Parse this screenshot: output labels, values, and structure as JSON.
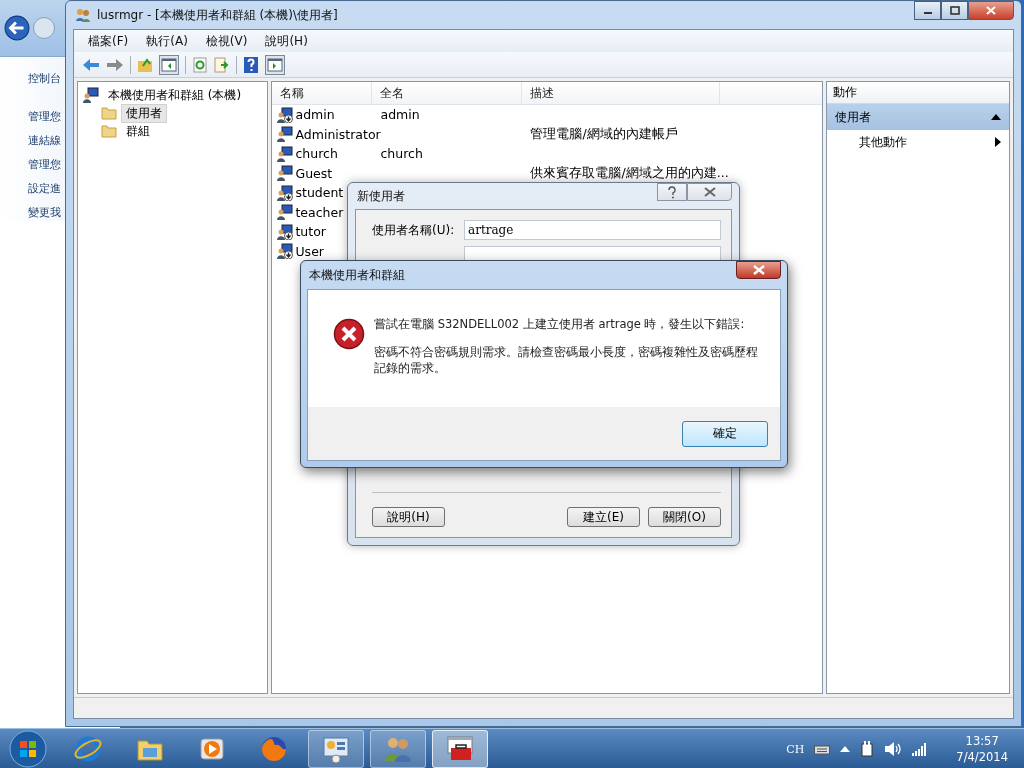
{
  "back_window": {
    "sidebar_items": [
      "控制台",
      "管理您",
      "連結線",
      "管理您",
      "設定進",
      "變更我"
    ]
  },
  "window": {
    "title": "lusrmgr - [本機使用者和群組 (本機)\\使用者]"
  },
  "menu": [
    "檔案(F)",
    "執行(A)",
    "檢視(V)",
    "說明(H)"
  ],
  "tree": {
    "label": "本機使用者和群組 (本機)",
    "children": [
      {
        "label": "使用者",
        "selected": true
      },
      {
        "label": "群組",
        "selected": false
      }
    ]
  },
  "table": {
    "columns": [
      "名稱",
      "全名",
      "描述"
    ],
    "rows": [
      {
        "name": "admin",
        "full_name": "admin",
        "disabled": true
      },
      {
        "name": "Administrator",
        "description": "管理電腦/網域的內建帳戶",
        "disabled": false
      },
      {
        "name": "church",
        "full_name": "church",
        "disabled": false
      },
      {
        "name": "Guest",
        "description": "供來賓存取電腦/網域之用的內建...",
        "disabled": false
      },
      {
        "name": "student",
        "disabled": true
      },
      {
        "name": "teacher",
        "disabled": false
      },
      {
        "name": "tutor",
        "disabled": true
      },
      {
        "name": "User",
        "disabled": true
      }
    ]
  },
  "actions": {
    "title": "動作",
    "sections": [
      {
        "label": "使用者",
        "expanded": true,
        "items": [
          "其他動作"
        ]
      }
    ]
  },
  "new_user_dialog": {
    "title": "新使用者",
    "fields": [
      {
        "label": "使用者名稱(U):",
        "value": "artrage"
      }
    ],
    "buttons": [
      "說明(H)",
      "建立(E)",
      "關閉(O)"
    ]
  },
  "error_dialog": {
    "title": "本機使用者和群組",
    "message": "嘗試在電腦 S32NDELL002 上建立使用者 artrage 時，發生以下錯誤:",
    "detail": "密碼不符合密碼規則需求。請檢查密碼最小長度，密碼複雜性及密碼歷程記錄的需求。",
    "button": "確定"
  },
  "taskbar": {
    "apps": [
      {
        "kind": "browser",
        "open": false,
        "selected": false
      },
      {
        "kind": "folder",
        "open": false,
        "selected": false
      },
      {
        "kind": "media",
        "open": false,
        "selected": false
      },
      {
        "kind": "globe",
        "open": false,
        "selected": false
      },
      {
        "kind": "panel",
        "open": true,
        "selected": false
      },
      {
        "kind": "users",
        "open": true,
        "selected": false
      },
      {
        "kind": "toolbox",
        "open": true,
        "selected": true
      }
    ],
    "language": "CH",
    "time": "13:57",
    "date": "7/4/2014"
  }
}
